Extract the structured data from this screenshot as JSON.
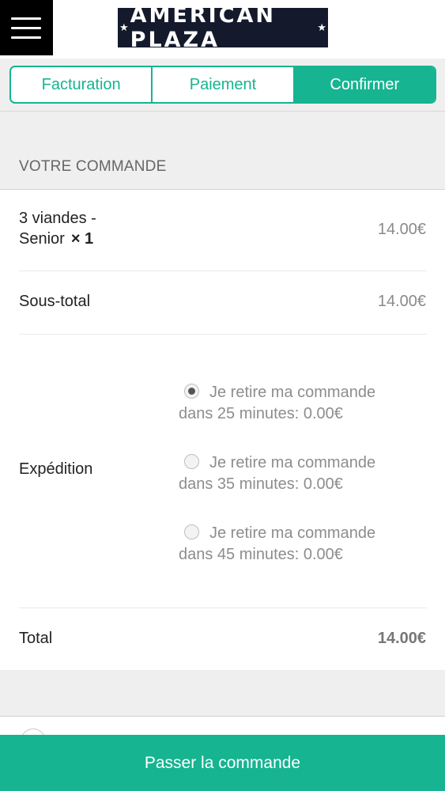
{
  "header": {
    "logo_text": "AMERICAN PLAZA",
    "logo_star": "★",
    "menu_icon": "hamburger-menu-icon"
  },
  "steps": [
    {
      "label": "Facturation",
      "active": false
    },
    {
      "label": "Paiement",
      "active": false
    },
    {
      "label": "Confirmer",
      "active": true
    }
  ],
  "order": {
    "section_title": "VOTRE COMMANDE",
    "item": {
      "name_line1": "3 viandes -",
      "name_line2": "Senior",
      "qty": "× 1",
      "price": "14.00€"
    },
    "subtotal": {
      "label": "Sous-total",
      "value": "14.00€"
    },
    "shipping": {
      "label": "Expédition",
      "options": [
        {
          "line1": "Je retire ma commande",
          "line2": "dans 25 minutes: 0.00€",
          "selected": true
        },
        {
          "line1": "Je retire ma commande",
          "line2": "dans 35 minutes: 0.00€",
          "selected": false
        },
        {
          "line1": "Je retire ma commande",
          "line2": "dans 45 minutes: 0.00€",
          "selected": false
        }
      ]
    },
    "total": {
      "label": "Total",
      "value": "14.00€"
    }
  },
  "place_order_label": "Passer la commande",
  "colors": {
    "accent": "#16b491",
    "logo_bg": "#141a2c"
  }
}
